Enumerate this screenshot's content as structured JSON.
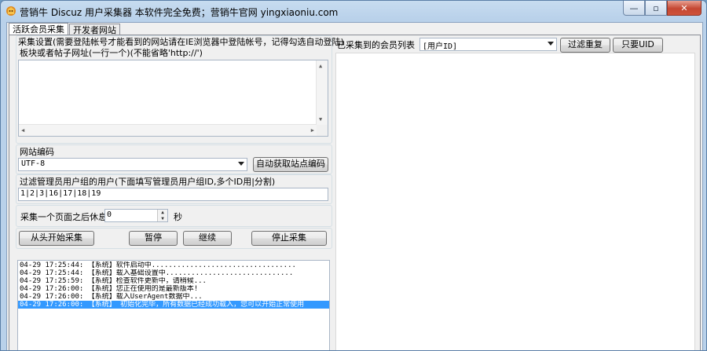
{
  "window": {
    "title": "营销牛 Discuz 用户采集器 本软件完全免费；营销牛官网 yingxiaoniu.com",
    "minimize_glyph": "—",
    "restore_glyph": "▫",
    "close_glyph": "✕"
  },
  "tabs": [
    {
      "label": "活跃会员采集"
    },
    {
      "label": "开发者网站"
    }
  ],
  "left": {
    "settings_title": "采集设置(需要登陆帐号才能看到的网站请在IE浏览器中登陆帐号，记得勾选自动登陆)",
    "url_label": "板块或者帖子网址(一行一个)(不能省略'http://')",
    "url_value": "",
    "encoding_label": "网站编码",
    "encoding_value": "UTF-8",
    "auto_encoding_button": "自动获取站点编码",
    "filter_label": "过滤管理员用户组的用户(下面填写管理员用户组ID,多个ID用|分割)",
    "filter_value": "1|2|3|16|17|18|19",
    "rest_label": "采集一个页面之后休息",
    "rest_value": "0",
    "rest_unit": "秒",
    "buttons": {
      "start": "从头开始采集",
      "pause": "暂停",
      "continue": "继续",
      "stop": "停止采集"
    },
    "log": [
      {
        "text": "04-29 17:25:44: 【系统】软件启动中..................................",
        "selected": false
      },
      {
        "text": "04-29 17:25:44: 【系统】载入基础设置中..............................",
        "selected": false
      },
      {
        "text": "04-29 17:25:59: 【系统】检查软件更新中，请稍候...",
        "selected": false
      },
      {
        "text": "04-29 17:26:00: 【系统】您正在使用的是最新版本!",
        "selected": false
      },
      {
        "text": "04-29 17:26:00: 【系统】载入UserAgent数据中...",
        "selected": false
      },
      {
        "text": "04-29 17:26:00: 【系统】 初始化完毕，所有数据已经成功载入，您可以开始正常使用",
        "selected": true
      }
    ]
  },
  "right": {
    "list_label": "已采集到的会员列表",
    "column_select": "[用户ID]",
    "filter_dup_button": "过滤重复",
    "uid_only_button": "只要UID"
  },
  "colors": {
    "selection": "#3399ff",
    "close_button": "#c44732"
  }
}
